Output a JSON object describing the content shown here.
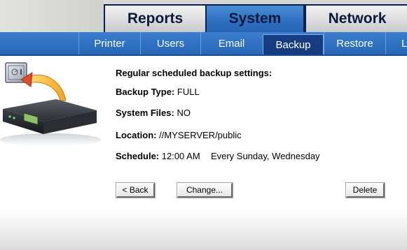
{
  "tabs": {
    "top": [
      {
        "label": "Reports",
        "active": false
      },
      {
        "label": "System",
        "active": true
      },
      {
        "label": "Network",
        "active": false
      }
    ],
    "sub": [
      {
        "label": "Printer",
        "active": false
      },
      {
        "label": "Users",
        "active": false
      },
      {
        "label": "Email",
        "active": false
      },
      {
        "label": "Backup",
        "active": true
      },
      {
        "label": "Restore",
        "active": false
      },
      {
        "label": "L",
        "active": false
      }
    ]
  },
  "backup": {
    "heading": "Regular scheduled backup settings:",
    "type_label": "Backup Type:",
    "type_value": "FULL",
    "sysfiles_label": "System Files:",
    "sysfiles_value": "NO",
    "location_label": "Location:",
    "location_value": "//MYSERVER/public",
    "schedule_label": "Schedule:",
    "schedule_time": "12:00 AM",
    "schedule_days": "Every Sunday, Wednesday"
  },
  "buttons": {
    "back": "< Back",
    "change": "Change...",
    "delete": "Delete"
  },
  "colors": {
    "accent_blue": "#2f72c3",
    "active_subtab": "#173f86",
    "tab_text": "#0b1a3a"
  },
  "icons": {
    "safe": "safe-icon",
    "arrow": "curved-arrow-icon",
    "server": "nas-device-icon"
  }
}
